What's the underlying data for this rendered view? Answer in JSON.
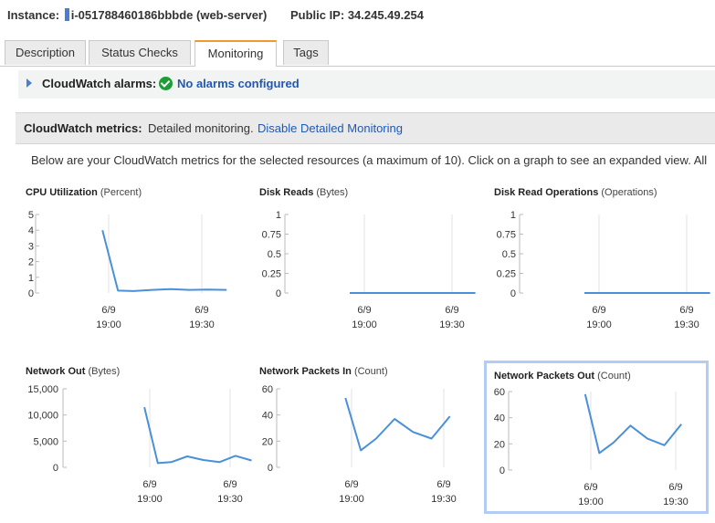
{
  "instance": {
    "label": "Instance:",
    "id_text": "i-051788460186bbbde (web-server)",
    "public_ip_label": "Public IP:",
    "public_ip": "34.245.49.254"
  },
  "tabs": [
    {
      "label": "Description"
    },
    {
      "label": "Status Checks"
    },
    {
      "label": "Monitoring",
      "active": true
    },
    {
      "label": "Tags"
    }
  ],
  "alarms": {
    "label": "CloudWatch alarms:",
    "status": "No alarms configured"
  },
  "metrics": {
    "label": "CloudWatch metrics:",
    "text": "Detailed monitoring.",
    "link": "Disable Detailed Monitoring",
    "intro": "Below are your CloudWatch metrics for the selected resources (a maximum of 10). Click on a graph to see an expanded view. All"
  },
  "colors": {
    "line": "#4a90d9",
    "accent_tab": "#f09a2e",
    "link": "#1f58b5",
    "ok": "#1d9d36",
    "selected_border": "#b3ccf5"
  },
  "chart_data": [
    {
      "type": "line",
      "title": "CPU Utilization",
      "unit": "(Percent)",
      "yticks": [
        "5",
        "4",
        "3",
        "2",
        "1",
        "0"
      ],
      "ylim": [
        0,
        5
      ],
      "xticks": [
        {
          "date": "6/9",
          "time": "19:00"
        },
        {
          "date": "6/9",
          "time": "19:30"
        }
      ],
      "x_minutes": [
        -2,
        3,
        8,
        14,
        20,
        26,
        32,
        38
      ],
      "series": [
        {
          "values": [
            4.0,
            0.15,
            0.12,
            0.2,
            0.25,
            0.2,
            0.22,
            0.2
          ]
        }
      ]
    },
    {
      "type": "line",
      "title": "Disk Reads",
      "unit": "(Bytes)",
      "yticks": [
        "1",
        "0.75",
        "0.5",
        "0.25",
        "0"
      ],
      "ylim": [
        0,
        1
      ],
      "xticks": [
        {
          "date": "6/9",
          "time": "19:00"
        },
        {
          "date": "6/9",
          "time": "19:30"
        }
      ],
      "x_minutes": [
        -5,
        38
      ],
      "series": [
        {
          "values": [
            0,
            0
          ]
        }
      ]
    },
    {
      "type": "line",
      "title": "Disk Read Operations",
      "unit": "(Operations)",
      "yticks": [
        "1",
        "0.75",
        "0.5",
        "0.25",
        "0"
      ],
      "ylim": [
        0,
        1
      ],
      "xticks": [
        {
          "date": "6/9",
          "time": "19:00"
        },
        {
          "date": "6/9",
          "time": "19:30"
        }
      ],
      "x_minutes": [
        -5,
        38
      ],
      "series": [
        {
          "values": [
            0,
            0
          ]
        }
      ]
    },
    {
      "type": "line",
      "title": "Network Out",
      "unit": "(Bytes)",
      "yticks": [
        "15,000",
        "10,000",
        "5,000",
        "0"
      ],
      "ylim": [
        0,
        15000
      ],
      "xticks": [
        {
          "date": "6/9",
          "time": "19:00"
        },
        {
          "date": "6/9",
          "time": "19:30"
        }
      ],
      "x_minutes": [
        -2,
        3,
        8,
        14,
        20,
        26,
        32,
        38
      ],
      "series": [
        {
          "values": [
            11500,
            800,
            1000,
            2100,
            1400,
            1000,
            2200,
            1300
          ]
        }
      ]
    },
    {
      "type": "line",
      "title": "Network Packets In",
      "unit": "(Count)",
      "yticks": [
        "60",
        "40",
        "20",
        "0"
      ],
      "ylim": [
        0,
        60
      ],
      "xticks": [
        {
          "date": "6/9",
          "time": "19:00"
        },
        {
          "date": "6/9",
          "time": "19:30"
        }
      ],
      "x_minutes": [
        -2,
        3,
        8,
        14,
        20,
        26,
        32
      ],
      "series": [
        {
          "values": [
            53,
            13,
            22,
            37,
            27,
            22,
            39
          ]
        }
      ]
    },
    {
      "type": "line",
      "title": "Network Packets Out",
      "unit": "(Count)",
      "yticks": [
        "60",
        "40",
        "20",
        "0"
      ],
      "ylim": [
        0,
        60
      ],
      "xticks": [
        {
          "date": "6/9",
          "time": "19:00"
        },
        {
          "date": "6/9",
          "time": "19:30"
        }
      ],
      "x_minutes": [
        -2,
        3,
        8,
        14,
        20,
        26,
        32
      ],
      "series": [
        {
          "values": [
            58,
            13,
            21,
            34,
            24,
            19,
            35
          ]
        }
      ],
      "selected": true
    }
  ]
}
